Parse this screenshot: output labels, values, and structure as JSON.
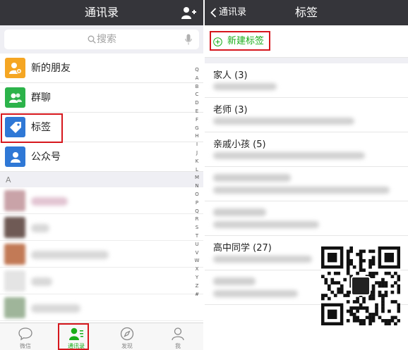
{
  "left": {
    "title": "通讯录",
    "search_placeholder": "搜索",
    "menu": [
      {
        "label": "新的朋友",
        "icon": "new-friend-icon",
        "color": "#f5a623"
      },
      {
        "label": "群聊",
        "icon": "group-chat-icon",
        "color": "#2cb34a"
      },
      {
        "label": "标签",
        "icon": "tag-icon",
        "color": "#2f78d6"
      },
      {
        "label": "公众号",
        "icon": "official-account-icon",
        "color": "#2f78d6"
      }
    ],
    "section_letter": "A",
    "index_letters": [
      "Q",
      "A",
      "B",
      "C",
      "D",
      "E",
      "F",
      "G",
      "H",
      "I",
      "J",
      "K",
      "L",
      "M",
      "N",
      "O",
      "P",
      "Q",
      "R",
      "S",
      "T",
      "U",
      "V",
      "W",
      "X",
      "Y",
      "Z",
      "#"
    ],
    "tabs": [
      {
        "label": "微信",
        "icon": "chat-bubble-icon"
      },
      {
        "label": "通讯录",
        "icon": "contacts-icon",
        "active": true
      },
      {
        "label": "发现",
        "icon": "compass-icon"
      },
      {
        "label": "我",
        "icon": "person-icon"
      }
    ]
  },
  "right": {
    "back_label": "通讯录",
    "title": "标签",
    "new_tag_label": "新建标签",
    "tags": [
      {
        "name": "家人 (3)"
      },
      {
        "name": "老师 (3)"
      },
      {
        "name": "亲戚小孩 (5)"
      },
      {
        "name": ""
      },
      {
        "name": ""
      },
      {
        "name": "高中同学 (27)"
      },
      {
        "name": ""
      }
    ]
  },
  "colors": {
    "navbar": "#35353a",
    "accent_green": "#1aad19",
    "highlight_red": "#d6171d"
  }
}
